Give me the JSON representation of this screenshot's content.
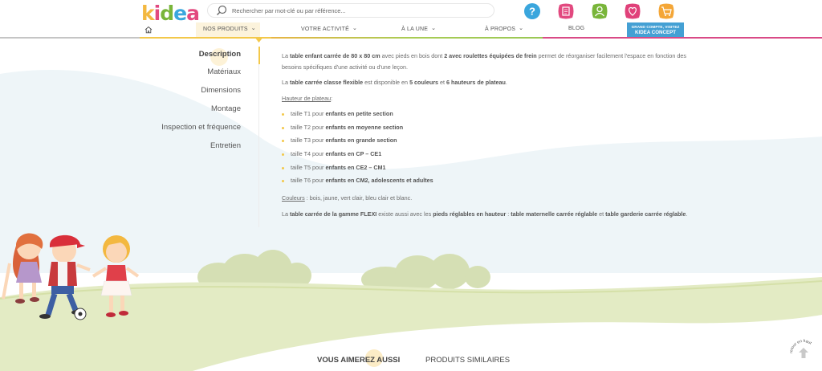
{
  "header": {
    "logo": "kidea",
    "search_placeholder": "Rechercher par mot-clé ou par référence...",
    "icons": [
      "help-icon",
      "catalog-icon",
      "account-icon",
      "wishlist-icon",
      "cart-icon"
    ],
    "nav": {
      "home_icon": "home-icon",
      "items": [
        {
          "label": "NOS PRODUITS",
          "dropdown": true
        },
        {
          "label": "VOTRE ACTIVITÉ",
          "dropdown": true
        },
        {
          "label": "À LA UNE",
          "dropdown": true
        },
        {
          "label": "À PROPOS",
          "dropdown": true
        },
        {
          "label": "BLOG",
          "dropdown": false
        }
      ]
    },
    "promo": {
      "line1": "GRAND COMPTE, VISITEZ",
      "line2": "KIDEA CONCEPT"
    }
  },
  "tabs": [
    {
      "label": "Description",
      "active": true
    },
    {
      "label": "Matériaux",
      "active": false
    },
    {
      "label": "Dimensions",
      "active": false
    },
    {
      "label": "Montage",
      "active": false
    },
    {
      "label": "Inspection et fréquence",
      "active": false
    },
    {
      "label": "Entretien",
      "active": false
    }
  ],
  "description": {
    "p1": [
      {
        "t": "La ",
        "b": false
      },
      {
        "t": "table enfant carrée de 80 x 80 cm",
        "b": true
      },
      {
        "t": " avec pieds en bois dont ",
        "b": false
      },
      {
        "t": "2 avec roulettes équipées de frein",
        "b": true
      },
      {
        "t": " permet de réorganiser facilement l'espace en fonction des besoins spécifiques d'une activité ou d'une leçon.",
        "b": false
      }
    ],
    "p2": [
      {
        "t": "La ",
        "b": false
      },
      {
        "t": "table carrée classe flexible",
        "b": true
      },
      {
        "t": " est disponible en ",
        "b": false
      },
      {
        "t": "5 couleurs",
        "b": true
      },
      {
        "t": " et ",
        "b": false
      },
      {
        "t": "6 hauteurs de plateau",
        "b": true
      },
      {
        "t": ".",
        "b": false
      }
    ],
    "heights_title": "Hauteur de plateau",
    "heights_suffix": " :",
    "sizes": [
      {
        "size": "taille T1",
        "mid": " pour ",
        "audience": "enfants en petite section"
      },
      {
        "size": "taille T2",
        "mid": " pour ",
        "audience": "enfants en moyenne section"
      },
      {
        "size": "taille T3",
        "mid": " pour ",
        "audience": "enfants en grande section"
      },
      {
        "size": "taille T4",
        "mid": " pour ",
        "audience": "enfants en CP – CE1"
      },
      {
        "size": "taille T5",
        "mid": " pour ",
        "audience": "enfants en CE2 – CM1"
      },
      {
        "size": "taille T6",
        "mid": " pour ",
        "audience": "enfants en CM2, adolescents et adultes"
      }
    ],
    "colors_label": "Couleurs",
    "colors_value": " : bois, jaune, vert clair, bleu clair et blanc.",
    "p5": [
      {
        "t": "La ",
        "b": false
      },
      {
        "t": "table carrée de la gamme FLEXI",
        "b": true
      },
      {
        "t": " existe aussi avec les ",
        "b": false
      },
      {
        "t": "pieds réglables en hauteur",
        "b": true
      },
      {
        "t": " : ",
        "b": false
      },
      {
        "t": "table maternelle carrée réglable",
        "b": true
      },
      {
        "t": " et ",
        "b": false
      },
      {
        "t": "table garderie carrée réglable",
        "b": true
      },
      {
        "t": ".",
        "b": false
      }
    ]
  },
  "bottom_tabs": [
    "VOUS AIMEREZ AUSSI",
    "PRODUITS SIMILAIRES"
  ],
  "back_to_top": "retour en haut",
  "colors": {
    "brand_yellow": "#f3c84a",
    "promo_blue": "#44a0d4",
    "help_blue": "#3aa6dd",
    "catalog_pink": "#e2497f",
    "account_green": "#79b53a",
    "wishlist_pink": "#e0417a",
    "cart_orange": "#f4a637",
    "hill_green": "#d7e3b4",
    "sky_blue": "#eef5f8"
  }
}
